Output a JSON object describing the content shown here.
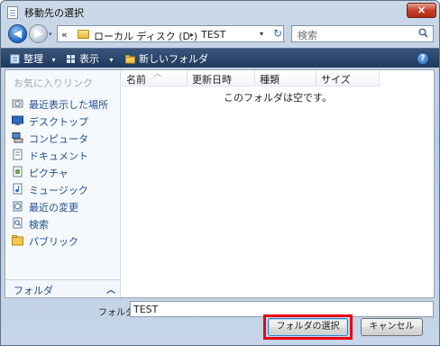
{
  "window": {
    "title": "移動先の選択",
    "close_label": "×"
  },
  "address": {
    "chevron": "«",
    "crumbs": [
      "ローカル ディスク (D:)",
      "TEST"
    ],
    "separator": "▸",
    "dropdown_glyph": "▾",
    "refresh_glyph": "↻"
  },
  "search": {
    "placeholder": "検索"
  },
  "nav": {
    "back_glyph": "◀",
    "forward_glyph": "▶",
    "history_glyph": "▾"
  },
  "toolbar": {
    "organize_label": "整理",
    "view_label": "表示",
    "new_folder_label": "新しいフォルダ",
    "dropdown_glyph": "▾",
    "help_label": "?"
  },
  "sidebar": {
    "favorites_header": "お気に入りリンク",
    "items": [
      {
        "label": "最近表示した場所",
        "icon": "recent-places-icon"
      },
      {
        "label": "デスクトップ",
        "icon": "desktop-icon"
      },
      {
        "label": "コンピュータ",
        "icon": "computer-icon"
      },
      {
        "label": "ドキュメント",
        "icon": "documents-icon"
      },
      {
        "label": "ピクチャ",
        "icon": "pictures-icon"
      },
      {
        "label": "ミュージック",
        "icon": "music-icon"
      },
      {
        "label": "最近の変更",
        "icon": "recently-changed-icon"
      },
      {
        "label": "検索",
        "icon": "searches-icon"
      },
      {
        "label": "パブリック",
        "icon": "public-folder-icon"
      }
    ],
    "folders_label": "フォルダ",
    "folders_chevron": "︿"
  },
  "file_list": {
    "columns": [
      "名前",
      "更新日時",
      "種類",
      "サイズ"
    ],
    "sort_glyph": "︿",
    "empty_message": "このフォルダは空です。"
  },
  "footer": {
    "folder_label": "フォルダ:",
    "folder_value": "TEST",
    "select_button": "フォルダの選択",
    "cancel_button": "キャンセル"
  },
  "colors": {
    "toolbar_bg": "#2b4a72",
    "link_blue": "#1d4f91",
    "highlight_red": "#e8000f",
    "close_red": "#c4402b"
  }
}
